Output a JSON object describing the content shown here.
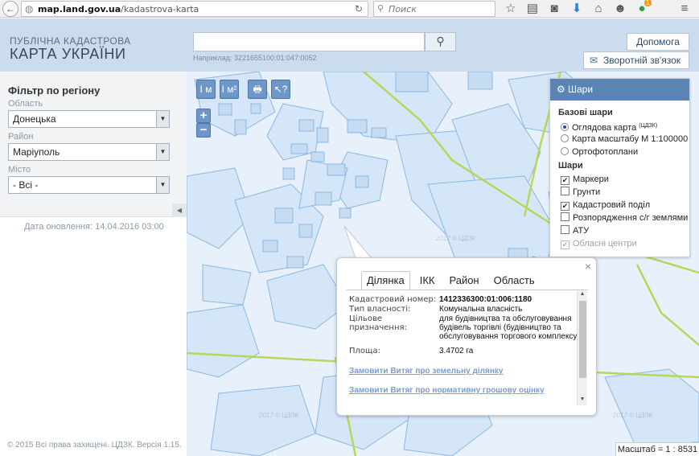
{
  "browser": {
    "url_host": "map.land.gov.ua",
    "url_path": "/kadastrova-karta",
    "search_placeholder": "Поиск",
    "badge_count": "1"
  },
  "header": {
    "logo_line1": "ПУБЛІЧНА КАДАСТРОВА",
    "logo_line2": "КАРТА УКРАЇНИ",
    "search_value": "",
    "example": "Наприклад: 3221655100:01:047:0052",
    "help_label": "Допомога",
    "feedback_label": "Зворотній зв'язок"
  },
  "filter": {
    "title": "Фільтр по регіону",
    "region_label": "Область",
    "region_value": "Донецька",
    "district_label": "Район",
    "district_value": "Маріуполь",
    "city_label": "Місто",
    "city_value": "- Всі -"
  },
  "updated": "Дата оновлення: 14.04.2016 03:00",
  "copyright": "© 2015 Всі права захищені. ЦДЗК. Версія 1.15.",
  "map": {
    "tools": [
      "I м",
      "I м²",
      "🖶",
      "↖?"
    ],
    "zoom_in": "+",
    "zoom_out": "−",
    "watermark": "2017 © ЦДЗК"
  },
  "layers": {
    "title": "Шари",
    "base_title": "Базові шари",
    "base": [
      {
        "label": "Оглядова карта",
        "sup": "(ЦДЗК)",
        "selected": true
      },
      {
        "label": "Карта масштабу М 1:100000",
        "sup": "",
        "selected": false
      },
      {
        "label": "Ортофотоплани",
        "sup": "",
        "selected": false
      }
    ],
    "layers_title": "Шари",
    "items": [
      {
        "label": "Маркери",
        "checked": true,
        "disabled": false
      },
      {
        "label": "Грунти",
        "checked": false,
        "disabled": false
      },
      {
        "label": "Кадастровий поділ",
        "checked": true,
        "disabled": false
      },
      {
        "label": "Розпорядження с/г землями",
        "checked": false,
        "disabled": false
      },
      {
        "label": "АТУ",
        "checked": false,
        "disabled": false
      },
      {
        "label": "Обласні центри",
        "checked": true,
        "disabled": true
      }
    ]
  },
  "popup": {
    "tabs": [
      "Ділянка",
      "ІКК",
      "Район",
      "Область"
    ],
    "close": "×",
    "rows": [
      {
        "label": "Кадастровий номер:",
        "value": "1412336300:01:006:1180"
      },
      {
        "label": "Тип власності:",
        "value": "Комунальна власність"
      },
      {
        "label": "Цільове призначення:",
        "value": "для будівництва та обслуговування будівель торгівлі (будівництво та обслуговування торгового комплексу)"
      },
      {
        "label": "Площа:",
        "value": "3.4702 га"
      }
    ],
    "link1": "Замовити Витяг про земельну ділянку",
    "link2": "Замовити Витяг про нормативну грошову оцінку"
  },
  "scale": "Масштаб = 1 : 8531"
}
